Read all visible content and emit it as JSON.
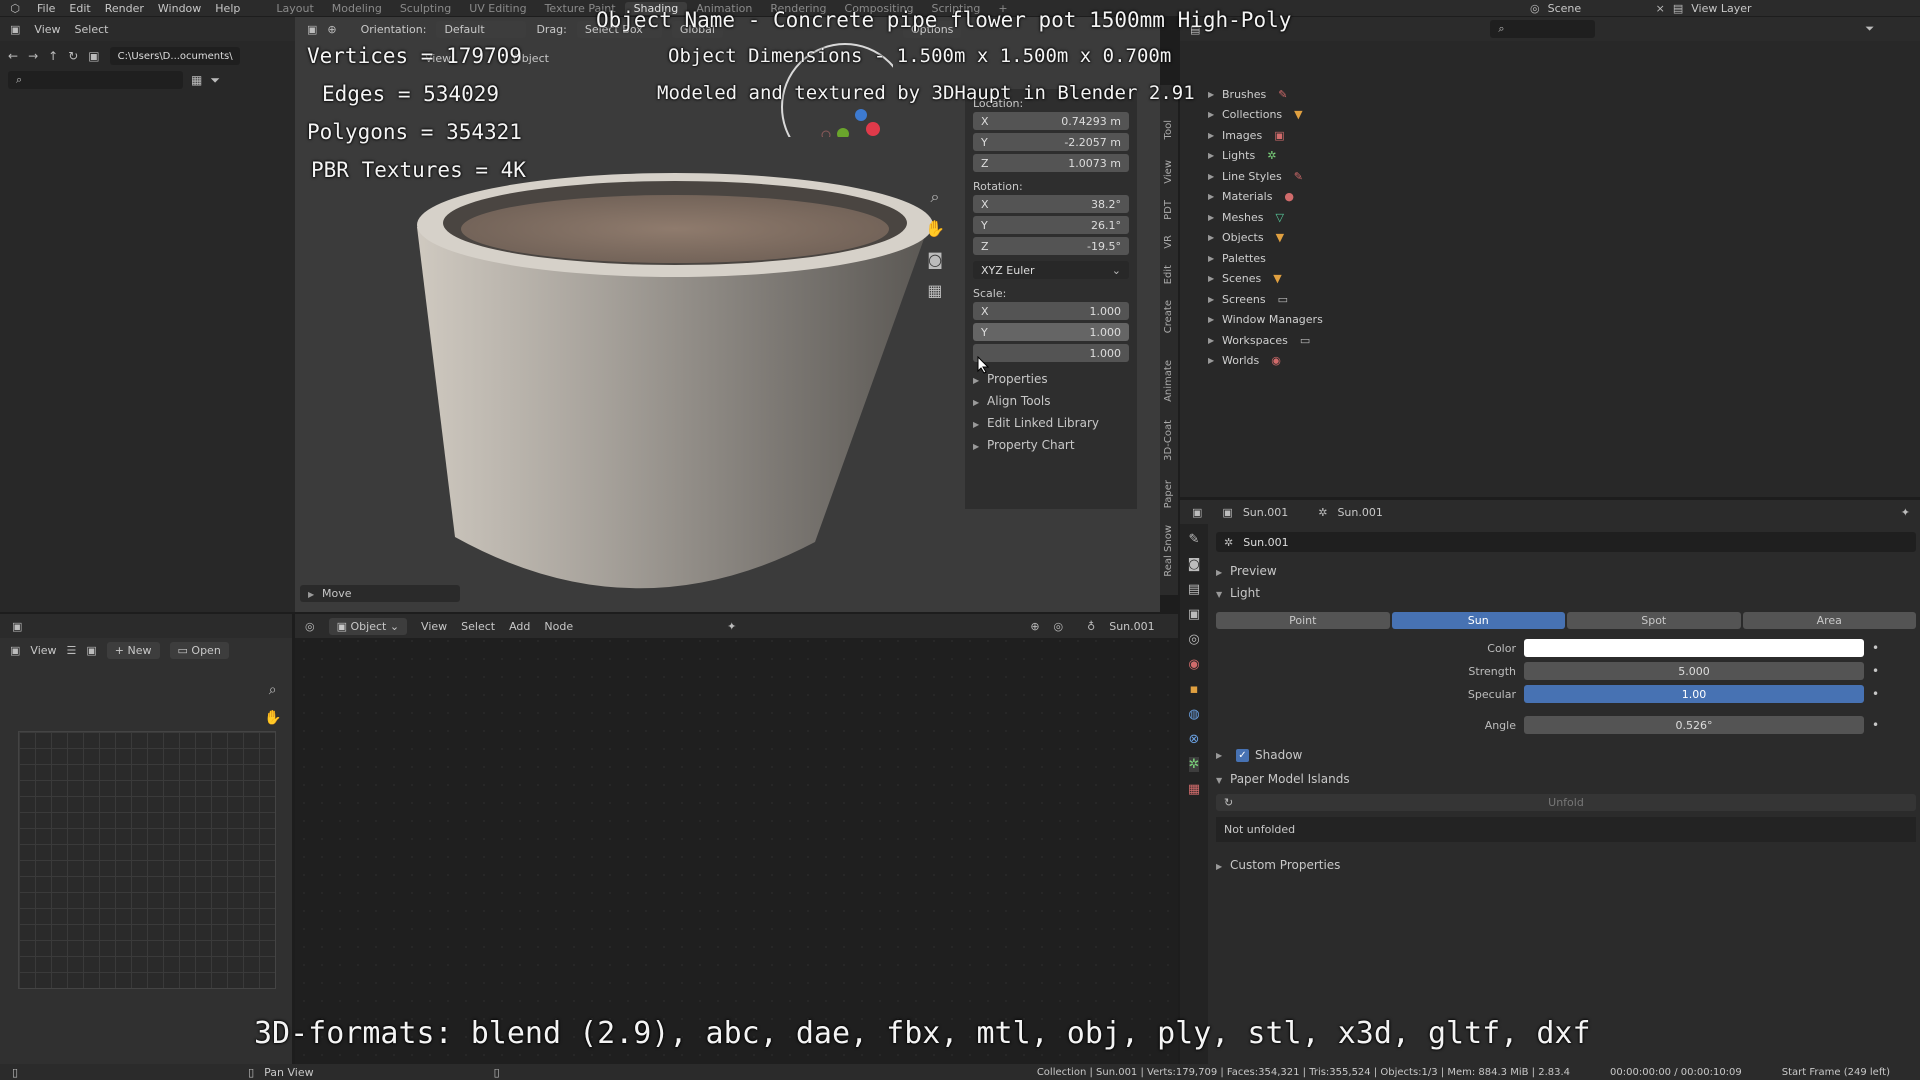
{
  "topbar": {
    "menu": [
      "File",
      "Edit",
      "Render",
      "Window",
      "Help"
    ],
    "workspaces": [
      "Layout",
      "Modeling",
      "Sculpting",
      "UV Editing",
      "Texture Paint",
      "Shading",
      "Animation",
      "Rendering",
      "Compositing",
      "Scripting"
    ],
    "active_workspace": "Shading",
    "scene": "Scene",
    "view_layer": "View Layer"
  },
  "filebrowser": {
    "view": "View",
    "select": "Select",
    "path": "C:\\Users\\D...ocuments\\"
  },
  "viewport": {
    "orientation_label": "Orientation:",
    "orientation_value": "Default",
    "drag_label": "Drag:",
    "drag_value": "Select Box",
    "transform_space": "Global",
    "options": "Options",
    "view": "View",
    "object": "Object",
    "last_op": "Move"
  },
  "overlay": {
    "vertices": "Vertices = 179709",
    "edges": "Edges = 534029",
    "polygons": "Polygons = 354321",
    "textures": "PBR Textures = 4K",
    "object_name": "Object Name - Concrete pipe flower pot 1500mm High-Poly",
    "dimensions": "Object Dimensions - 1.500m x 1.500m x 0.700m",
    "modeled": "Modeled and textured by 3DHaupt in Blender 2.91",
    "formats": "3D-formats: blend (2.9), abc, dae, fbx, mtl, obj, ply, stl, x3d, gltf, dxf"
  },
  "npanel": {
    "location_label": "Location:",
    "location": [
      {
        "axis": "X",
        "value": "0.74293 m"
      },
      {
        "axis": "Y",
        "value": "-2.2057 m"
      },
      {
        "axis": "Z",
        "value": "1.0073 m"
      }
    ],
    "rotation_label": "Rotation:",
    "rotation": [
      {
        "axis": "X",
        "value": "38.2°"
      },
      {
        "axis": "Y",
        "value": "26.1°"
      },
      {
        "axis": "Z",
        "value": "-19.5°"
      }
    ],
    "rotation_mode": "XYZ Euler",
    "scale_label": "Scale:",
    "scale": [
      {
        "axis": "X",
        "value": "1.000"
      },
      {
        "axis": "Y",
        "value": "1.000"
      },
      {
        "axis": "",
        "value": "1.000"
      }
    ],
    "sections": [
      "Properties",
      "Align Tools",
      "Edit Linked Library",
      "Property Chart"
    ],
    "tabs": [
      "Tool",
      "View",
      "PDT",
      "VR",
      "Edit",
      "Create",
      "Animate",
      "3D-Coat",
      "Paper",
      "Real Snow"
    ]
  },
  "outliner": {
    "items": [
      "Brushes",
      "Collections",
      "Images",
      "Lights",
      "Line Styles",
      "Materials",
      "Meshes",
      "Objects",
      "Palettes",
      "Scenes",
      "Screens",
      "Window Managers",
      "Workspaces",
      "Worlds"
    ]
  },
  "properties": {
    "object_tab": "Sun.001",
    "data_tab": "Sun.001",
    "datablock": "Sun.001",
    "preview": "Preview",
    "light": "Light",
    "light_types": [
      "Point",
      "Sun",
      "Spot",
      "Area"
    ],
    "active_type": "Sun",
    "color_label": "Color",
    "strength_label": "Strength",
    "strength": "5.000",
    "specular_label": "Specular",
    "specular": "1.00",
    "angle_label": "Angle",
    "angle": "0.526°",
    "shadow": "Shadow",
    "paper_islands": "Paper Model Islands",
    "unfold": "Unfold",
    "not_unfolded": "Not unfolded",
    "custom_props": "Custom Properties"
  },
  "image_editor": {
    "view": "View",
    "new": "New",
    "open": "Open"
  },
  "node_editor": {
    "mode": "Object",
    "view": "View",
    "select": "Select",
    "add": "Add",
    "node": "Node",
    "object": "Sun.001"
  },
  "statusbar": {
    "left": "Pan View",
    "right": "Collection | Sun.001 | Verts:179,709 | Faces:354,321 | Tris:355,524 | Objects:1/3 | Mem: 884.3 MiB | 2.83.4",
    "time": "00:00:00:00 / 00:00:10:09",
    "frame": "Start Frame (249 left)"
  },
  "colors": {
    "accent": "#4772b3",
    "light_color": "#ffffff"
  }
}
